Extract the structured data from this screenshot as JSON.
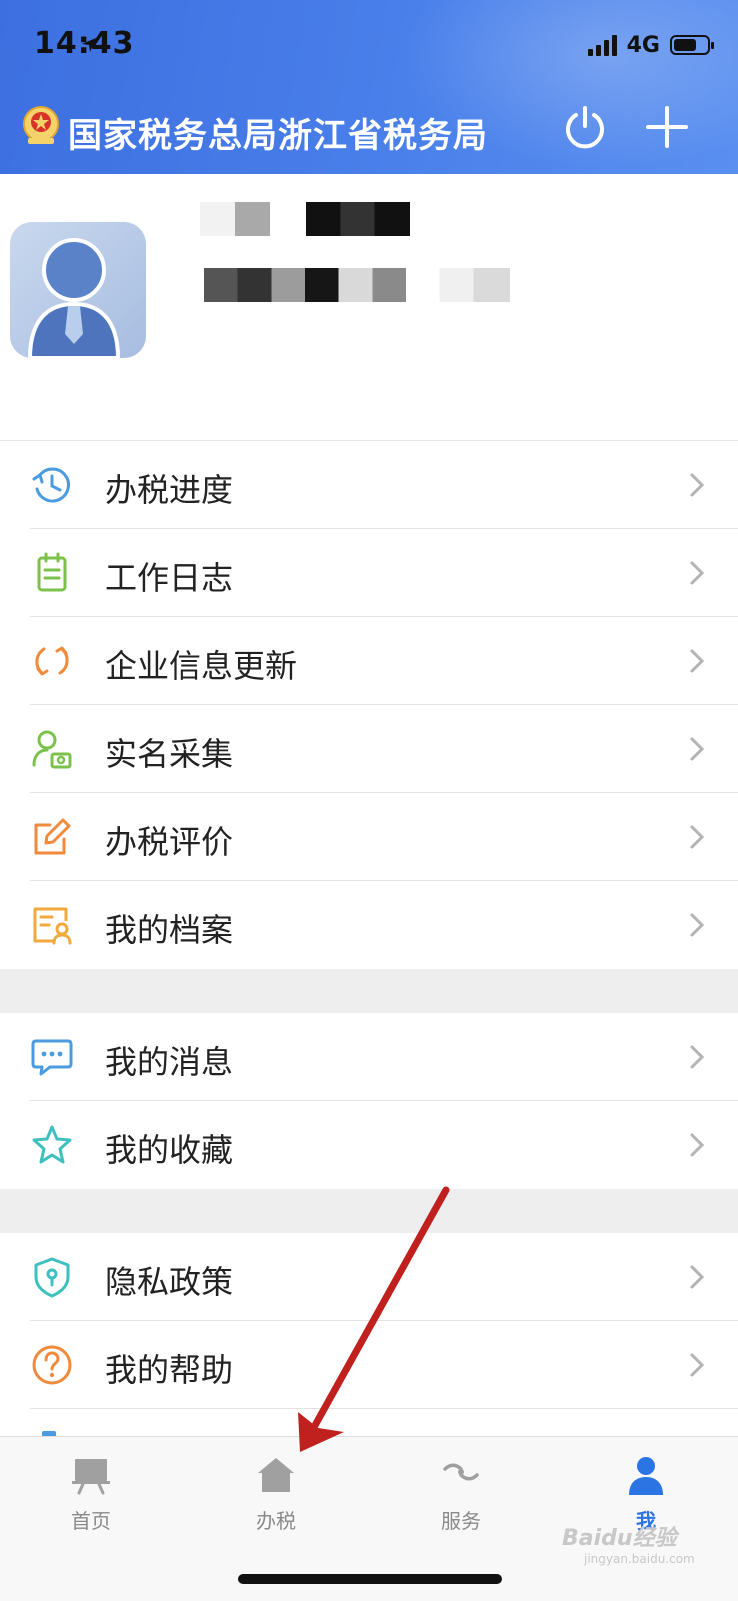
{
  "status_bar": {
    "time": "14:43",
    "network": "4G"
  },
  "header": {
    "title": "国家税务总局浙江省税务局"
  },
  "menu_groups": [
    {
      "items": [
        {
          "label": "办税进度",
          "icon": "clock-history-icon"
        },
        {
          "label": "工作日志",
          "icon": "notebook-icon"
        },
        {
          "label": "企业信息更新",
          "icon": "refresh-icon"
        },
        {
          "label": "实名采集",
          "icon": "user-camera-icon"
        },
        {
          "label": "办税评价",
          "icon": "edit-icon"
        },
        {
          "label": "我的档案",
          "icon": "profile-card-icon"
        }
      ]
    },
    {
      "items": [
        {
          "label": "我的消息",
          "icon": "chat-bubble-icon"
        },
        {
          "label": "我的收藏",
          "icon": "star-icon"
        }
      ]
    },
    {
      "items": [
        {
          "label": "隐私政策",
          "icon": "shield-icon"
        },
        {
          "label": "我的帮助",
          "icon": "help-icon"
        }
      ]
    }
  ],
  "tabbar": {
    "tabs": [
      {
        "label": "首页",
        "icon": "presentation-board-icon",
        "active": false
      },
      {
        "label": "办税",
        "icon": "house-icon",
        "active": false
      },
      {
        "label": "服务",
        "icon": "service-icon",
        "active": false
      },
      {
        "label": "我",
        "icon": "person-icon",
        "active": true
      }
    ]
  },
  "watermark": {
    "text": "Baidu经验",
    "sub": "jingyan.baidu.com"
  },
  "colors": {
    "header_blue": "#4a80ea",
    "active_tab": "#2b74e4",
    "annotation_arrow": "#c0201e"
  }
}
